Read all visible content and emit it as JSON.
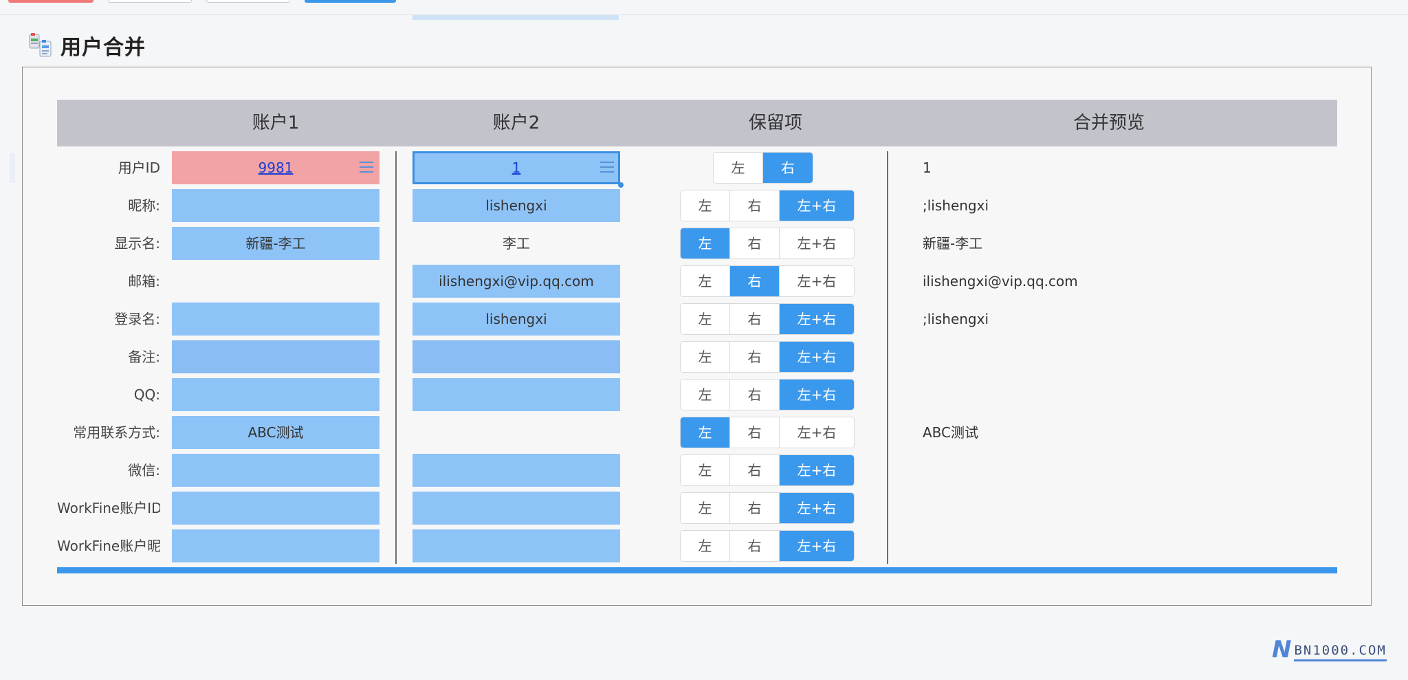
{
  "page": {
    "title": "用户合并"
  },
  "table": {
    "headers": {
      "account1": "账户1",
      "account2": "账户2",
      "keep": "保留项",
      "preview": "合并预览"
    },
    "options": {
      "left": "左",
      "right": "右",
      "both": "左+右"
    },
    "rows": [
      {
        "label": "用户ID",
        "left": "9981",
        "right": "1",
        "keep": "right",
        "preview": "1"
      },
      {
        "label": "昵称:",
        "left": "",
        "right": "lishengxi",
        "keep": "both",
        "preview": ";lishengxi"
      },
      {
        "label": "显示名:",
        "left": "新疆-李工",
        "right": "李工",
        "keep": "left",
        "preview": "新疆-李工"
      },
      {
        "label": "邮箱:",
        "left": "",
        "right": "ilishengxi@vip.qq.com",
        "keep": "right",
        "preview": "ilishengxi@vip.qq.com"
      },
      {
        "label": "登录名:",
        "left": "",
        "right": "lishengxi",
        "keep": "both",
        "preview": ";lishengxi"
      },
      {
        "label": "备注:",
        "left": "",
        "right": "",
        "keep": "both",
        "preview": ""
      },
      {
        "label": "QQ:",
        "left": "",
        "right": "",
        "keep": "both",
        "preview": ""
      },
      {
        "label": "常用联系方式:",
        "left": "ABC测试",
        "right": "",
        "keep": "left",
        "preview": "ABC测试"
      },
      {
        "label": "微信:",
        "left": "",
        "right": "",
        "keep": "both",
        "preview": ""
      },
      {
        "label": "WorkFine账户ID:",
        "left": "",
        "right": "",
        "keep": "both",
        "preview": ""
      },
      {
        "label": "WorkFine账户昵称",
        "left": "",
        "right": "",
        "keep": "both",
        "preview": ""
      }
    ]
  },
  "watermark": {
    "letter": "N",
    "text": "BN1000.COM"
  },
  "colors": {
    "accent": "#3b99ed",
    "cell_fill": "#8ec3f7",
    "cell_highlight": "#f1a3a5",
    "header_bg": "#c3c4cb"
  }
}
